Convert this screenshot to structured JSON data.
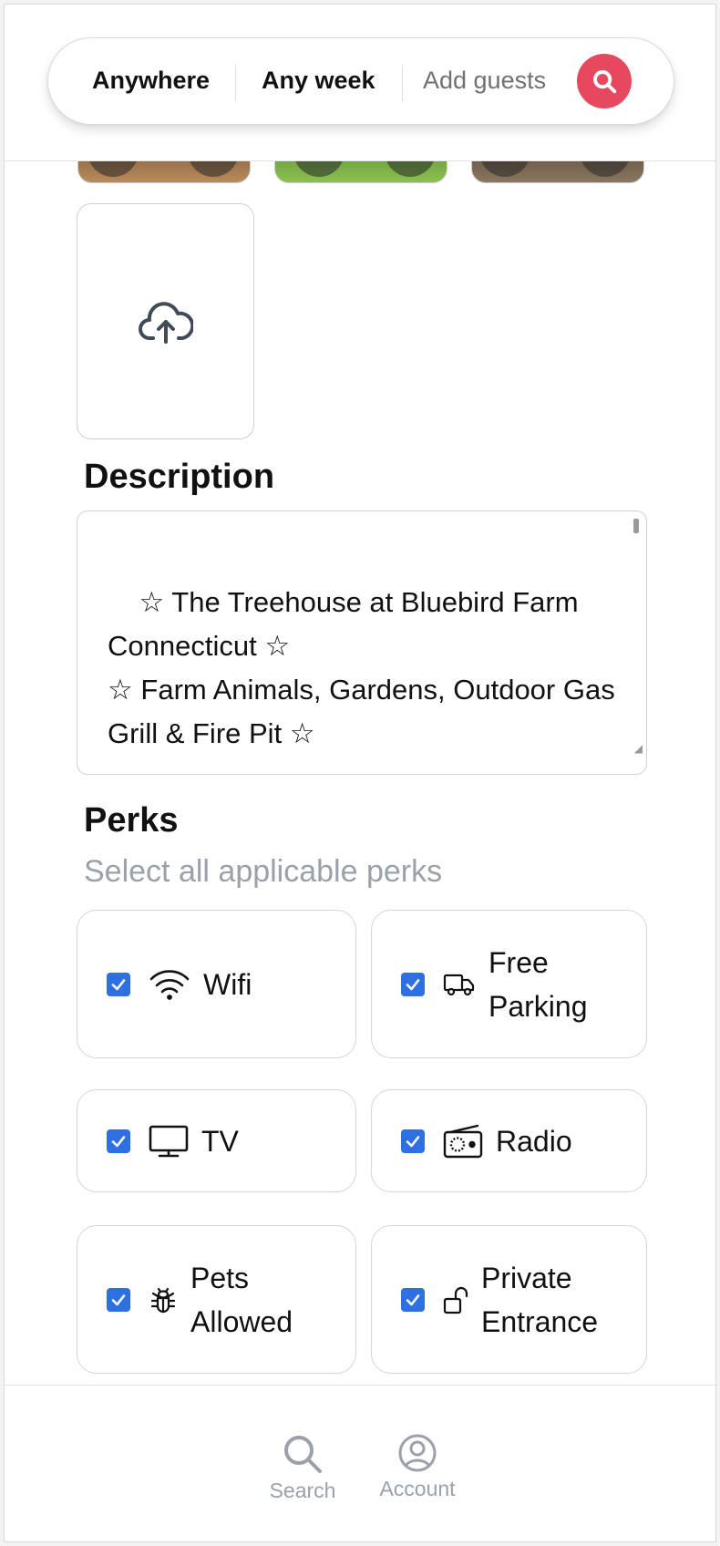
{
  "search_bar": {
    "location": "Anywhere",
    "dates": "Any week",
    "guests_placeholder": "Add guests",
    "accent_color": "#e5485f"
  },
  "photos": {
    "upload_icon": "cloud-upload-icon"
  },
  "description": {
    "title": "Description",
    "text": "☆ The Treehouse at Bluebird Farm Connecticut ☆\n☆ Farm Animals, Gardens, Outdoor Gas Grill & Fire Pit ☆\n\nOMG! Explore the countryside at this"
  },
  "perks": {
    "title": "Perks",
    "subtitle": "Select all applicable perks",
    "checkbox_color": "#2f6fe4",
    "items": [
      {
        "label": "Wifi",
        "icon": "wifi-icon",
        "checked": true
      },
      {
        "label": "Free Parking",
        "icon": "truck-icon",
        "checked": true
      },
      {
        "label": "TV",
        "icon": "monitor-icon",
        "checked": true
      },
      {
        "label": "Radio",
        "icon": "radio-icon",
        "checked": true
      },
      {
        "label": "Pets Allowed",
        "icon": "bug-icon",
        "checked": true
      },
      {
        "label": "Private Entrance",
        "icon": "lock-open-icon",
        "checked": true
      }
    ]
  },
  "bottom_nav": {
    "search_label": "Search",
    "account_label": "Account"
  }
}
